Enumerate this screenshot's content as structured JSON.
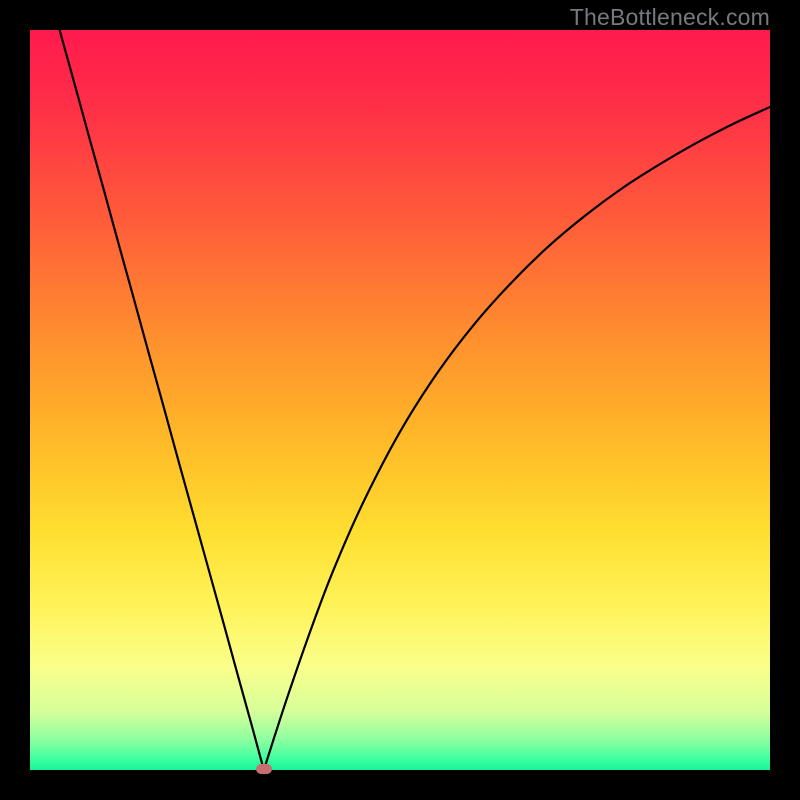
{
  "watermark": "TheBottleneck.com",
  "colors": {
    "frame": "#000000",
    "curve": "#000000",
    "marker": "#c96d70",
    "gradient_stops": [
      {
        "offset": 0.0,
        "color": "#ff1a4e"
      },
      {
        "offset": 0.1,
        "color": "#ff2e47"
      },
      {
        "offset": 0.25,
        "color": "#ff5a3a"
      },
      {
        "offset": 0.4,
        "color": "#ff8a2f"
      },
      {
        "offset": 0.55,
        "color": "#ffb828"
      },
      {
        "offset": 0.68,
        "color": "#ffdf30"
      },
      {
        "offset": 0.78,
        "color": "#fff35a"
      },
      {
        "offset": 0.86,
        "color": "#faff8a"
      },
      {
        "offset": 0.92,
        "color": "#d7ff9a"
      },
      {
        "offset": 0.96,
        "color": "#8bffa0"
      },
      {
        "offset": 0.985,
        "color": "#3effa0"
      },
      {
        "offset": 1.0,
        "color": "#17f39b"
      }
    ]
  },
  "chart_data": {
    "type": "line",
    "title": "",
    "xlabel": "",
    "ylabel": "",
    "xlim": [
      0,
      100
    ],
    "ylim": [
      0,
      100
    ],
    "min_x": 31.6,
    "marker": {
      "x": 31.6,
      "y": 0
    },
    "series": [
      {
        "name": "curve",
        "x": [
          4.0,
          6,
          8,
          10,
          12,
          14,
          16,
          18,
          20,
          22,
          24,
          26,
          28,
          30,
          31.6,
          33,
          35,
          38,
          41,
          45,
          50,
          55,
          60,
          65,
          70,
          75,
          80,
          85,
          90,
          95,
          100
        ],
        "values": [
          100,
          92.8,
          85.5,
          78.3,
          71.0,
          63.8,
          56.5,
          49.3,
          42.0,
          34.8,
          27.6,
          20.4,
          13.1,
          5.9,
          0.0,
          4.4,
          10.5,
          19.1,
          27.0,
          36.1,
          45.7,
          53.6,
          60.2,
          65.8,
          70.7,
          74.9,
          78.6,
          81.8,
          84.7,
          87.3,
          89.6
        ]
      }
    ]
  }
}
